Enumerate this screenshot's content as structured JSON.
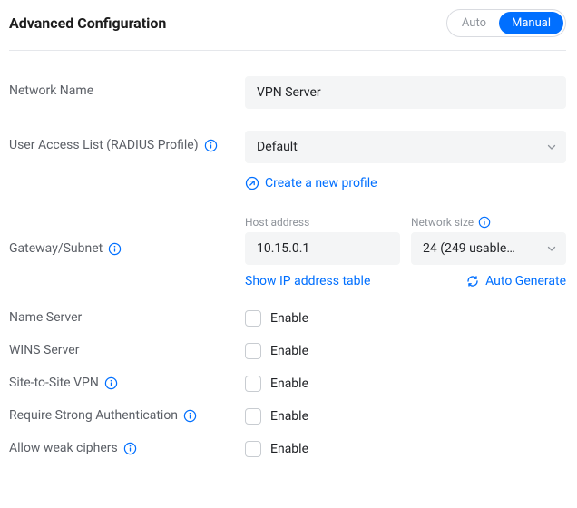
{
  "header": {
    "title": "Advanced Configuration",
    "seg_auto": "Auto",
    "seg_manual": "Manual"
  },
  "network_name": {
    "label": "Network Name",
    "value": "VPN Server"
  },
  "user_access": {
    "label": "User Access List (RADIUS Profile)",
    "value": "Default",
    "create_link": "Create a new profile"
  },
  "gateway": {
    "label": "Gateway/Subnet",
    "host_label": "Host address",
    "host_value": "10.15.0.1",
    "size_label": "Network size",
    "size_value": "24 (249 usable…",
    "show_table": "Show IP address table",
    "auto_gen": "Auto Generate"
  },
  "name_server": {
    "label": "Name Server",
    "enable": "Enable"
  },
  "wins_server": {
    "label": "WINS Server",
    "enable": "Enable"
  },
  "s2s_vpn": {
    "label": "Site-to-Site VPN",
    "enable": "Enable"
  },
  "strong_auth": {
    "label": "Require Strong Authentication",
    "enable": "Enable"
  },
  "weak_ciphers": {
    "label": "Allow weak ciphers",
    "enable": "Enable"
  }
}
